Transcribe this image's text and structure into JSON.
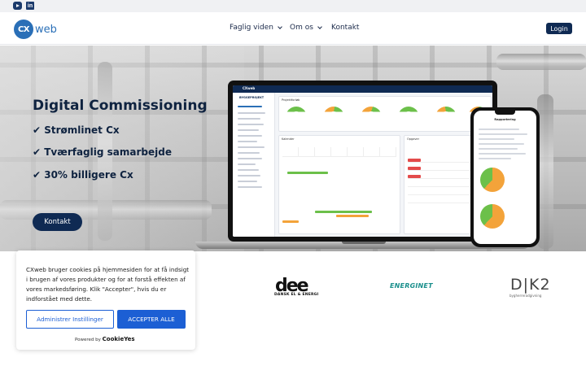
{
  "social": {
    "youtube_icon": "youtube-icon",
    "linkedin_icon": "linkedin-icon",
    "linkedin_glyph": "in"
  },
  "header": {
    "logo_mark": "CX",
    "logo_word": "web",
    "nav": [
      {
        "label": "Faglig viden",
        "has_dropdown": true
      },
      {
        "label": "Om os",
        "has_dropdown": true
      },
      {
        "label": "Kontakt",
        "has_dropdown": false
      }
    ],
    "login_label": "Login"
  },
  "hero": {
    "title": "Digital Commissioning",
    "bullets": [
      "✔ Strømlinet Cx",
      "✔ Tværfaglig samarbejde",
      "✔ 30% billigere Cx"
    ],
    "cta_label": "Kontakt"
  },
  "logos": {
    "dee_mark": "dee",
    "dee_sub": "DANSK EL & ENERGI",
    "energinet": "ENERGINET",
    "dk2_mark": "D|K2",
    "dk2_sub": "bygherreradgivning"
  },
  "cookie": {
    "text": "CXweb bruger cookies på hjemmesiden for at få indsigt i brugen af vores produkter og for at forstå effekten af vores markedsføring. Klik \"Accepter\", hvis du er indforstået med dette.",
    "admin_label": "Administrer Instillinger",
    "accept_label": "ACCEPTER ALLE",
    "powered_prefix": "Powered by",
    "powered_brand": "CookieYes"
  },
  "colors": {
    "brand_navy": "#0f2a53",
    "logo_blue": "#2a6fb7",
    "cookie_blue": "#1c5fd4",
    "energinet_teal": "#1a8f8c"
  }
}
